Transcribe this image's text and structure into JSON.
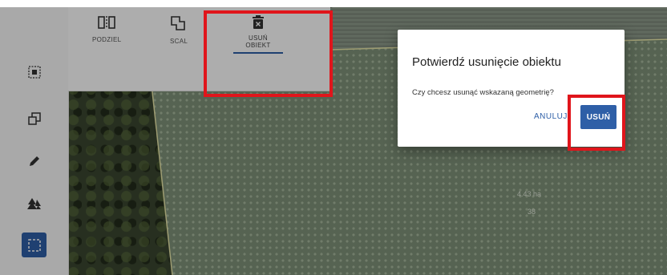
{
  "toolbar": {
    "tools": [
      {
        "label": "PODZIEL",
        "icon": "split-icon"
      },
      {
        "label": "SCAL",
        "icon": "merge-icon"
      },
      {
        "label_line1": "USUŃ",
        "label_line2": "OBIEKT",
        "icon": "delete-object-icon",
        "active": true
      }
    ]
  },
  "sidebar": {
    "items": [
      {
        "icon": "select-object-icon"
      },
      {
        "icon": "copy-icon"
      },
      {
        "icon": "pencil-icon"
      },
      {
        "icon": "trees-icon"
      },
      {
        "icon": "selection-area-icon",
        "active": true
      }
    ]
  },
  "map": {
    "area_label": "4.43 ha",
    "parcel_number": "38"
  },
  "dialog": {
    "title": "Potwierdź usunięcie obiektu",
    "message": "Czy chcesz usunąć wskazaną geometrię?",
    "cancel_label": "ANULUJ",
    "confirm_label": "USUŃ"
  },
  "colors": {
    "accent": "#2e5fa7",
    "highlight": "#e0151b"
  }
}
